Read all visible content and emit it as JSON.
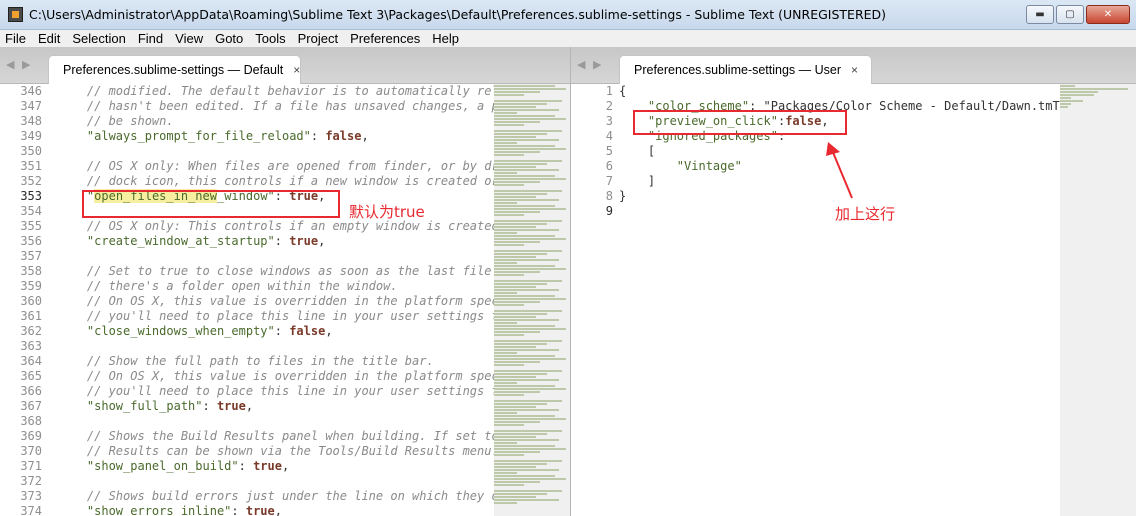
{
  "window": {
    "title": "C:\\Users\\Administrator\\AppData\\Roaming\\Sublime Text 3\\Packages\\Default\\Preferences.sublime-settings - Sublime Text (UNREGISTERED)",
    "controls": [
      "minimize",
      "maximize",
      "close"
    ]
  },
  "menu": [
    "File",
    "Edit",
    "Selection",
    "Find",
    "View",
    "Goto",
    "Tools",
    "Project",
    "Preferences",
    "Help"
  ],
  "left_pane": {
    "nav_arrows": "◀ ▶",
    "tab_label": "Preferences.sublime-settings — Default",
    "tab_close": "×",
    "lines": [
      {
        "n": "346",
        "t": "    // modified. The default behavior is to automatically relo"
      },
      {
        "n": "347",
        "t": "    // hasn't been edited. If a file has unsaved changes, a pr"
      },
      {
        "n": "348",
        "t": "    // be shown."
      },
      {
        "n": "349",
        "t": "    \"always_prompt_for_file_reload\": false,"
      },
      {
        "n": "350",
        "t": ""
      },
      {
        "n": "351",
        "t": "    // OS X only: When files are opened from finder, or by dra"
      },
      {
        "n": "352",
        "t": "    // dock icon, this controls if a new window is created or"
      },
      {
        "n": "353",
        "t": "    \"open_files_in_new_window\": true,"
      },
      {
        "n": "354",
        "t": ""
      },
      {
        "n": "355",
        "t": "    // OS X only: This controls if an empty window is created"
      },
      {
        "n": "356",
        "t": "    \"create_window_at_startup\": true,"
      },
      {
        "n": "357",
        "t": ""
      },
      {
        "n": "358",
        "t": "    // Set to true to close windows as soon as the last file i"
      },
      {
        "n": "359",
        "t": "    // there's a folder open within the window."
      },
      {
        "n": "360",
        "t": "    // On OS X, this value is overridden in the platform spect"
      },
      {
        "n": "361",
        "t": "    // you'll need to place this line in your user settings to"
      },
      {
        "n": "362",
        "t": "    \"close_windows_when_empty\": false,"
      },
      {
        "n": "363",
        "t": ""
      },
      {
        "n": "364",
        "t": "    // Show the full path to files in the title bar."
      },
      {
        "n": "365",
        "t": "    // On OS X, this value is overridden in the platform spect"
      },
      {
        "n": "366",
        "t": "    // you'll need to place this line in your user settings to"
      },
      {
        "n": "367",
        "t": "    \"show_full_path\": true,"
      },
      {
        "n": "368",
        "t": ""
      },
      {
        "n": "369",
        "t": "    // Shows the Build Results panel when building. If set to"
      },
      {
        "n": "370",
        "t": "    // Results can be shown via the Tools/Build Results menu."
      },
      {
        "n": "371",
        "t": "    \"show_panel_on_build\": true,"
      },
      {
        "n": "372",
        "t": ""
      },
      {
        "n": "373",
        "t": "    // Shows build errors just under the line on which they oc"
      },
      {
        "n": "374",
        "t": "    \"show_errors_inline\": true,"
      }
    ],
    "active_line": "353",
    "annotation": "默认为true"
  },
  "right_pane": {
    "nav_arrows": "◀ ▶",
    "tab_label": "Preferences.sublime-settings — User",
    "tab_close": "×",
    "lines": [
      {
        "n": "1",
        "t": "{"
      },
      {
        "n": "2",
        "t": "    \"color_scheme\": \"Packages/Color Scheme - Default/Dawn.tmThe"
      },
      {
        "n": "3",
        "t": "    \"preview_on_click\":false,"
      },
      {
        "n": "4",
        "t": "    \"ignored_packages\":"
      },
      {
        "n": "5",
        "t": "    ["
      },
      {
        "n": "6",
        "t": "        \"Vintage\""
      },
      {
        "n": "7",
        "t": "    ]"
      },
      {
        "n": "8",
        "t": "}"
      },
      {
        "n": "9",
        "t": ""
      }
    ],
    "active_line": "9",
    "annotation": "加上这行"
  },
  "colors": {
    "annotation_red": "#e8292f",
    "highlight": "#f6efa0"
  }
}
